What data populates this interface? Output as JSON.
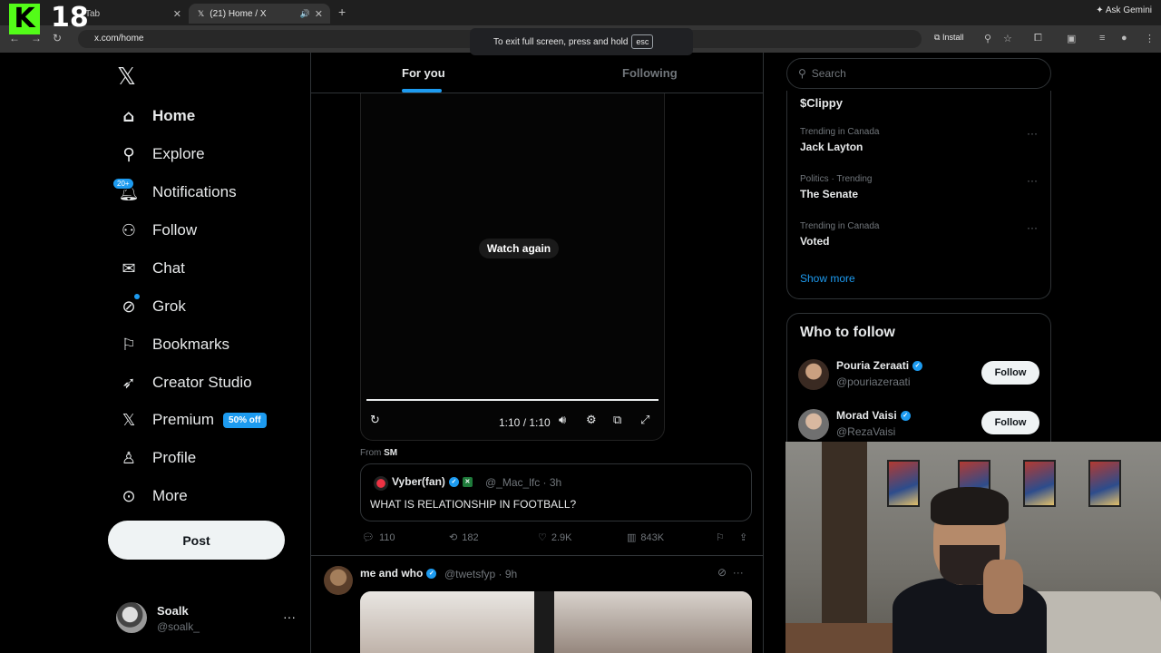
{
  "browser": {
    "tabs": [
      {
        "title": "Tab",
        "active": false
      },
      {
        "title": "(21) Home / X",
        "active": true
      }
    ],
    "url": "x.com/home",
    "install_label": "Install",
    "ask_gemini": "Ask Gemini",
    "fullscreen_toast": "To exit full screen, press and hold",
    "fullscreen_key": "esc"
  },
  "overlay": {
    "logo_letter": "K",
    "number": "18",
    "logo_color": "#53fc18"
  },
  "sidebar": {
    "items": [
      {
        "label": "Home",
        "icon": "home-icon"
      },
      {
        "label": "Explore",
        "icon": "search-icon"
      },
      {
        "label": "Notifications",
        "icon": "bell-icon",
        "badge": "20+"
      },
      {
        "label": "Follow",
        "icon": "person-plus-icon"
      },
      {
        "label": "Chat",
        "icon": "mail-icon"
      },
      {
        "label": "Grok",
        "icon": "grok-icon"
      },
      {
        "label": "Bookmarks",
        "icon": "bookmark-icon"
      },
      {
        "label": "Creator Studio",
        "icon": "rocket-icon"
      },
      {
        "label": "Premium",
        "icon": "x-icon",
        "badge": "50% off"
      },
      {
        "label": "Profile",
        "icon": "person-icon"
      },
      {
        "label": "More",
        "icon": "more-circle-icon"
      }
    ],
    "post_label": "Post",
    "profile": {
      "name": "Soalk",
      "handle": "@soalk_"
    }
  },
  "timeline": {
    "tabs": {
      "for_you": "For you",
      "following": "Following"
    },
    "video": {
      "watch_again": "Watch again",
      "time": "1:10 / 1:10"
    },
    "from_prefix": "From",
    "from_source": "SM",
    "quote": {
      "name": "Vyber(fan)",
      "handle": "@_Mac_lfc · 3h",
      "text": "WHAT IS RELATIONSHIP IN FOOTBALL?"
    },
    "actions": {
      "replies": "110",
      "reposts": "182",
      "likes": "2.9K",
      "views": "843K"
    },
    "next_tweet": {
      "name": "me and who",
      "handle": "@twetsfyp · 9h"
    }
  },
  "right": {
    "search_placeholder": "Search",
    "trend_top": "$Clippy",
    "trends": [
      {
        "context": "Trending in Canada",
        "name": "Jack Layton"
      },
      {
        "context": "Politics · Trending",
        "name": "The Senate"
      },
      {
        "context": "Trending in Canada",
        "name": "Voted"
      }
    ],
    "show_more": "Show more",
    "who_to_follow": {
      "title": "Who to follow",
      "people": [
        {
          "name": "Pouria Zeraati",
          "handle": "@pouriazeraati",
          "button": "Follow"
        },
        {
          "name": "Morad Vaisi",
          "handle": "@RezaVaisi",
          "button": "Follow"
        }
      ]
    }
  },
  "colors": {
    "accent": "#1d9bf0",
    "background": "#000000",
    "border": "#2f3336",
    "muted": "#71767b"
  }
}
